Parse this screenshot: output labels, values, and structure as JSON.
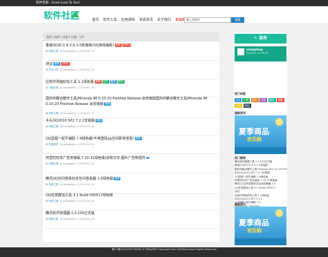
{
  "topbar": {
    "text": "软件无限 - Good Luck To You!"
  },
  "header": {
    "logo_text": "软件社区",
    "nav": [
      "首页",
      "软件工具",
      "应用游戏",
      "资源资讯",
      "关于我们",
      "本站商城"
    ],
    "search_placeholder": "输入关键字",
    "search_button": "搜索"
  },
  "main": {
    "breadcrumb": "首页 / 软件 / 全部 / 分类：1/9",
    "posts": [
      {
        "title": "重装QQ实习 9.3.9.1.0安装版(QQ游戏辅助)",
        "badges": [
          {
            "text": "推荐",
            "color": "red"
          },
          {
            "text": "[资讯]",
            "color": "red"
          }
        ],
        "category": "系统工具",
        "author": "songqiang",
        "date": "2024-01-14"
      },
      {
        "title": "测试",
        "badges": [
          {
            "text": "推荐",
            "color": "blue"
          },
          {
            "text": "[资讯]",
            "color": "red"
          }
        ],
        "category": "中文小写",
        "author": "songqiang",
        "date": "2024-01-14"
      },
      {
        "title": "应软件界面好玩工具 1.1绿色版",
        "badges": [
          {
            "text": "推荐",
            "color": "red"
          },
          {
            "text": "站长",
            "color": "green"
          },
          {
            "text": "置顶",
            "color": "blue"
          },
          {
            "text": "精华",
            "color": "green"
          }
        ],
        "category": "中国元宵",
        "author": "songqiang",
        "date": "2024-01-14"
      },
      {
        "title": "国外的聚合聊天工具|Miranda IM 0.10.20 PreView Release 会安装版国外的聚合聊天工具|Miranda IM 0.10.20 PreView Release 会安装版",
        "badges": [
          {
            "text": "推荐",
            "color": "blue"
          }
        ],
        "category": "系统工具",
        "author": "songqiang",
        "date": "2024-01-14"
      },
      {
        "title": "木头QQ2010 SP2 7.2.2安装版",
        "badges": [
          {
            "text": "推荐",
            "color": "blue"
          }
        ],
        "category": "系统工具",
        "author": "songqiang",
        "date": "2024-01-14"
      },
      {
        "title": "QQ显靓一起牛辅助 7.9绿色版(不用登陆qq空间即将查看)",
        "badges": [
          {
            "text": "推荐",
            "color": "blue"
          }
        ],
        "category": "应用软件",
        "author": "songqiang",
        "date": "2024-01-14"
      },
      {
        "title": "阿里旺旺去广告安装版 7.20.31绿色版|去除文字,图片广告和插件",
        "badges": [],
        "category": "中国元宵",
        "author": "songqiang",
        "date": "2024-01-14"
      },
      {
        "title": "腾讯QQ空间查看好友空间查看器 1.0绿色版",
        "badges": [
          {
            "text": "推荐",
            "color": "blue"
          }
        ],
        "category": "系统工具",
        "author": "songqiang",
        "date": "2024-01-14"
      },
      {
        "title": "QQ任意群加工具 3.1 Build 090517绿色版",
        "badges": [],
        "category": "系统工具",
        "author": "songqiang",
        "date": "2024-01-14"
      },
      {
        "title": "腾讯软件管理器 2.3.100正式版",
        "badges": [],
        "category": "系统工具",
        "author": "songqiang",
        "date": "2024-01-14"
      }
    ]
  },
  "sidebar": {
    "publish_label": "发布",
    "user_name": "songqiang",
    "user_date": "2024-01-14 09:26",
    "tags_title": "热门标签",
    "tags": [
      {
        "text": "QQ",
        "color": "#3498db"
      },
      {
        "text": "工具",
        "color": "#27ae60"
      },
      {
        "text": "绿色",
        "color": "#e67e22"
      },
      {
        "text": "安装",
        "color": "#9b59b6"
      },
      {
        "text": "聊天",
        "color": "#1abc9c"
      },
      {
        "text": "辅助",
        "color": "#e74c3c"
      },
      {
        "text": "游戏",
        "color": "#f1c40f"
      },
      {
        "text": "软件",
        "color": "#34495e"
      }
    ],
    "ad1_title": "最新资讯",
    "banner_text1": "夏季商品",
    "banner_text2": "欢乐购",
    "hot_title": "热门推荐",
    "hot_list": [
      "腾讯软件管理工具 2.3.100正式版",
      "重装QQ实习 9.3.9.1.0安装版",
      "国外的聚合聊天工具 Miranda IM 0.10.20 PreView Release",
      "木头QQ2010 SP2 7.2.2安装版",
      "QQ显靓一起牛辅助 7.9绿色版",
      "阿里旺旺去广告安装版 7.20.31绿色版",
      "腾讯QQ空间查看好友空间查看器 1.0",
      "QQ任意群加工具 3.1 Build 090517",
      "测试",
      "应软件界面好玩工具 1.1绿色版",
      "木头QQ2010 SP2 7.2.2",
      "QQ显靓一起牛辅助 7.9",
      "阿里旺旺去广告安装版",
      "腾讯软件管理器 2.3.100正式版"
    ],
    "ad2_title": "最新资讯"
  },
  "footer": {
    "text": "蜀ICP备12022007290号-12 ZBlogPHP Copyright Your WebSite.Some Rights Reserved"
  }
}
